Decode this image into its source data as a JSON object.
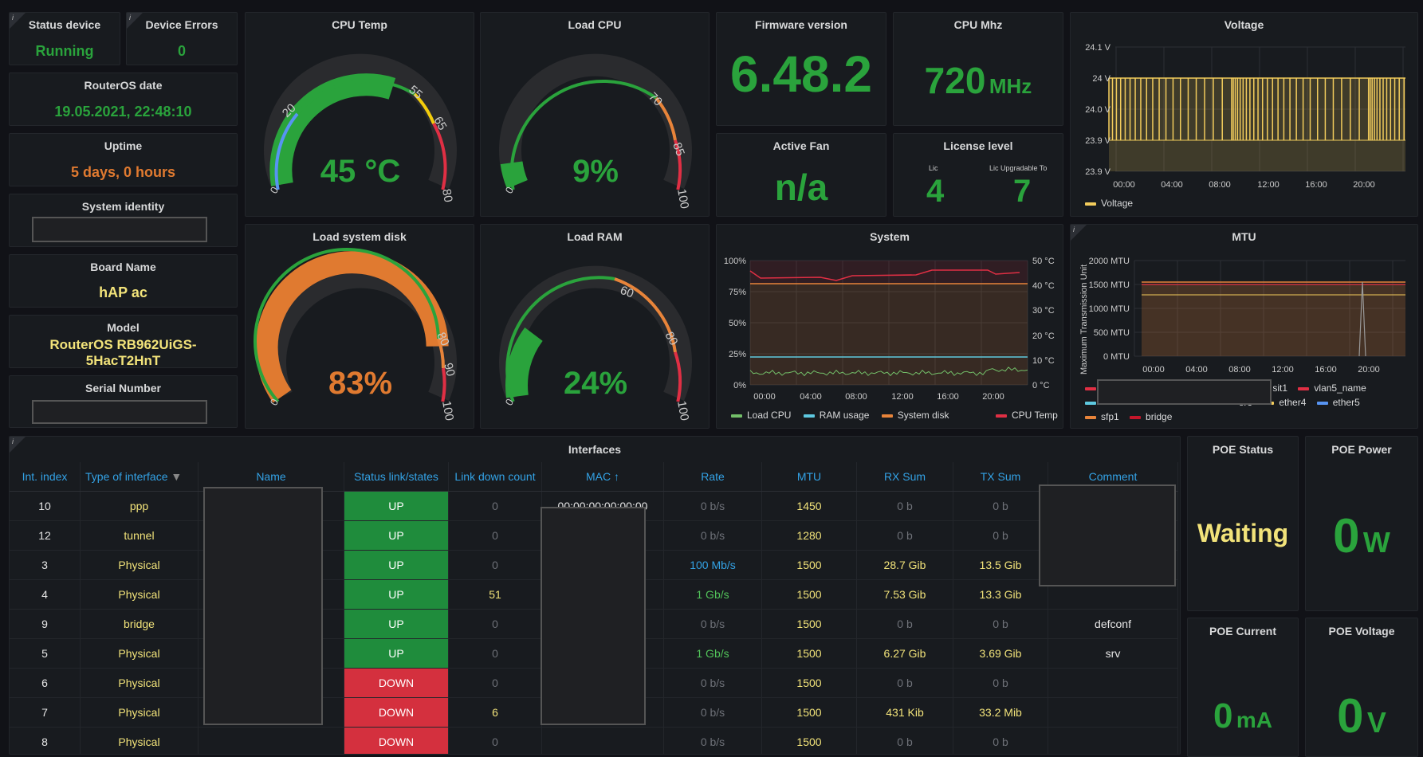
{
  "status_device": {
    "title": "Status device",
    "value": "Running"
  },
  "device_errors": {
    "title": "Device Errors",
    "value": "0"
  },
  "routeros_date": {
    "title": "RouterOS date",
    "value": "19.05.2021, 22:48:10"
  },
  "uptime": {
    "title": "Uptime",
    "value": "5 days, 0 hours"
  },
  "system_identity": {
    "title": "System identity"
  },
  "board_name": {
    "title": "Board Name",
    "value": "hAP ac"
  },
  "model": {
    "title": "Model",
    "line1": "RouterOS RB962UiGS-",
    "line2": "5HacT2HnT"
  },
  "serial_number": {
    "title": "Serial Number"
  },
  "cpu_temp": {
    "title": "CPU Temp",
    "value": "45 °C",
    "min": 0,
    "max": 80,
    "current": 45,
    "ticks": [
      "0",
      "20",
      "55",
      "65",
      "80"
    ]
  },
  "load_cpu": {
    "title": "Load CPU",
    "value": "9%",
    "min": 0,
    "max": 100,
    "current": 9,
    "ticks": [
      "0",
      "70",
      "85",
      "100"
    ]
  },
  "load_disk": {
    "title": "Load system disk",
    "value": "83%",
    "min": 0,
    "max": 100,
    "current": 83,
    "ticks": [
      "0",
      "80",
      "90",
      "100"
    ]
  },
  "load_ram": {
    "title": "Load RAM",
    "value": "24%",
    "min": 0,
    "max": 100,
    "current": 24,
    "ticks": [
      "0",
      "60",
      "80",
      "100"
    ]
  },
  "firmware": {
    "title": "Firmware version",
    "value": "6.48.2"
  },
  "cpu_mhz": {
    "title": "CPU Mhz",
    "value": "720",
    "unit": "MHz"
  },
  "active_fan": {
    "title": "Active Fan",
    "value": "n/a"
  },
  "license": {
    "title": "License level",
    "lic_label": "Lic",
    "lic_value": "4",
    "upg_label": "Lic Upgradable To",
    "upg_value": "7"
  },
  "voltage": {
    "title": "Voltage",
    "yticks": [
      "24.1 V",
      "24 V",
      "24.0 V",
      "23.9 V",
      "23.9 V"
    ],
    "xticks": [
      "00:00",
      "04:00",
      "08:00",
      "12:00",
      "16:00",
      "20:00"
    ],
    "legend": "Voltage",
    "color": "#f2cc5c"
  },
  "system": {
    "title": "System",
    "yleft": [
      "100%",
      "75%",
      "50%",
      "25%",
      "0%"
    ],
    "yright": [
      "50 °C",
      "40 °C",
      "30 °C",
      "20 °C",
      "10 °C",
      "0 °C"
    ],
    "xticks": [
      "00:00",
      "04:00",
      "08:00",
      "12:00",
      "16:00",
      "20:00"
    ],
    "legend": [
      {
        "name": "Load CPU",
        "color": "#73bf69"
      },
      {
        "name": "RAM usage",
        "color": "#5ec9e0"
      },
      {
        "name": "System disk",
        "color": "#e8843a"
      },
      {
        "name": "CPU Temp",
        "color": "#e02f44"
      }
    ]
  },
  "mtu": {
    "title": "MTU",
    "ylabel": "Maximum Transmission Unit",
    "yticks": [
      "2000 MTU",
      "1500 MTU",
      "1000 MTU",
      "500 MTU",
      "0 MTU"
    ],
    "xticks": [
      "00:00",
      "04:00",
      "08:00",
      "12:00",
      "16:00",
      "20:00"
    ],
    "legend_row1": [
      {
        "name": "st",
        "color": "#e8843a"
      },
      {
        "name": "sit1",
        "color": "#e8843a"
      },
      {
        "name": "vlan5_name",
        "color": "#e02f44"
      }
    ],
    "legend_row2": [
      {
        "name": "er3",
        "color": "#e8843a"
      },
      {
        "name": "ether4",
        "color": "#f2cc5c"
      },
      {
        "name": "ether5",
        "color": "#5794f2"
      }
    ],
    "legend_row3": [
      {
        "name": "sfp1",
        "color": "#e8843a"
      },
      {
        "name": "bridge",
        "color": "#c4162a"
      }
    ]
  },
  "interfaces": {
    "title": "Interfaces",
    "columns": [
      "Int. index",
      "Type of interface",
      "Name",
      "Status link/states",
      "Link down count",
      "MAC",
      "Rate",
      "MTU",
      "RX Sum",
      "TX Sum",
      "Comment"
    ],
    "rows": [
      {
        "idx": "10",
        "type": "ppp",
        "status": "UP",
        "down": "0",
        "mac": "00:00:00:00:00:00",
        "rate": "0 b/s",
        "mtu": "1450",
        "rx": "0 b",
        "tx": "0 b",
        "comment": ""
      },
      {
        "idx": "12",
        "type": "tunnel",
        "status": "UP",
        "down": "0",
        "mac": "",
        "rate": "0 b/s",
        "mtu": "1280",
        "rx": "0 b",
        "tx": "0 b",
        "comment": ""
      },
      {
        "idx": "3",
        "type": "Physical",
        "status": "UP",
        "down": "0",
        "mac": "",
        "rate": "100 Mb/s",
        "mtu": "1500",
        "rx": "28.7 Gib",
        "tx": "13.5 Gib",
        "comment": ""
      },
      {
        "idx": "4",
        "type": "Physical",
        "status": "UP",
        "down": "51",
        "mac": "",
        "rate": "1 Gb/s",
        "mtu": "1500",
        "rx": "7.53 Gib",
        "tx": "13.3 Gib",
        "comment": ""
      },
      {
        "idx": "9",
        "type": "bridge",
        "status": "UP",
        "down": "0",
        "mac": "",
        "rate": "0 b/s",
        "mtu": "1500",
        "rx": "0 b",
        "tx": "0 b",
        "comment": "defconf"
      },
      {
        "idx": "5",
        "type": "Physical",
        "status": "UP",
        "down": "0",
        "mac": "",
        "rate": "1 Gb/s",
        "mtu": "1500",
        "rx": "6.27 Gib",
        "tx": "3.69 Gib",
        "comment": "srv"
      },
      {
        "idx": "6",
        "type": "Physical",
        "status": "DOWN",
        "down": "0",
        "mac": "",
        "rate": "0 b/s",
        "mtu": "1500",
        "rx": "0 b",
        "tx": "0 b",
        "comment": ""
      },
      {
        "idx": "7",
        "type": "Physical",
        "status": "DOWN",
        "down": "6",
        "mac": "",
        "rate": "0 b/s",
        "mtu": "1500",
        "rx": "431 Kib",
        "tx": "33.2 Mib",
        "comment": ""
      },
      {
        "idx": "8",
        "type": "Physical",
        "status": "DOWN",
        "down": "0",
        "mac": "",
        "rate": "0 b/s",
        "mtu": "1500",
        "rx": "0 b",
        "tx": "0 b",
        "comment": ""
      }
    ]
  },
  "poe_status": {
    "title": "POE Status",
    "value": "Waiting"
  },
  "poe_power": {
    "title": "POE Power",
    "value": "0",
    "unit": "W"
  },
  "poe_current": {
    "title": "POE Current",
    "value": "0",
    "unit": "mA"
  },
  "poe_voltage": {
    "title": "POE Voltage",
    "value": "0",
    "unit": "V"
  }
}
